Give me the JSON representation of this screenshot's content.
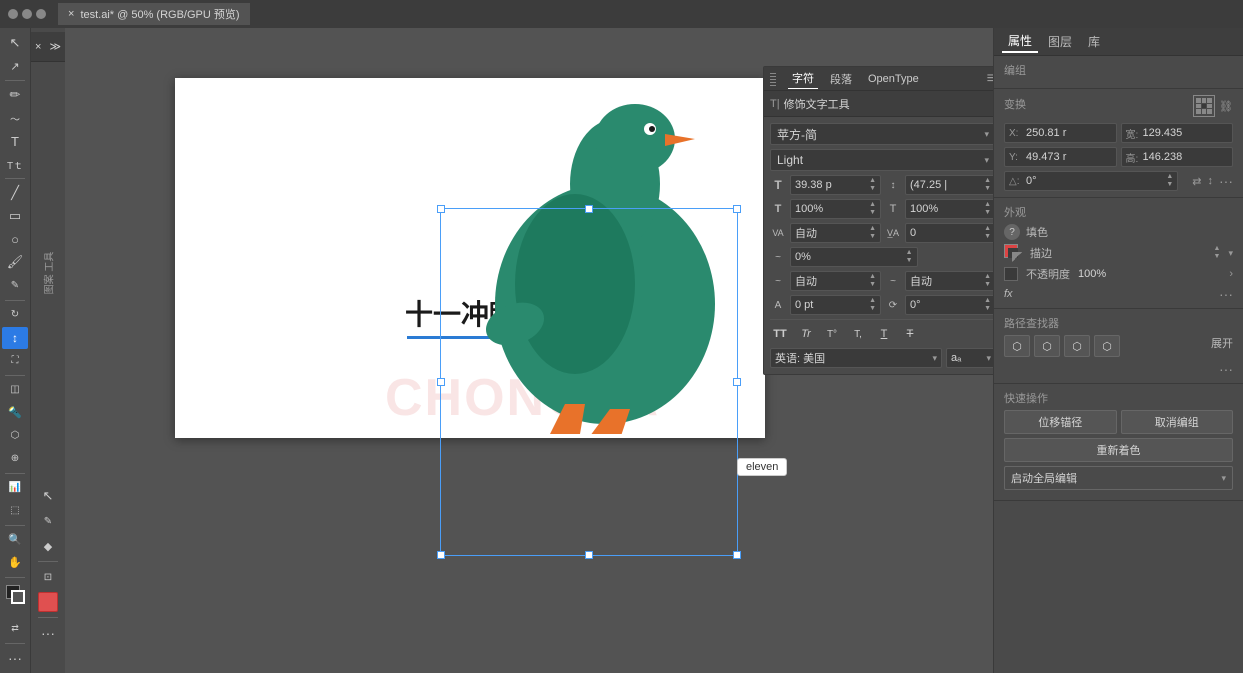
{
  "titlebar": {
    "title": "test.ai* @ 50% (RGB/GPU 预览)",
    "tab_close": "×"
  },
  "toolbar": {
    "tools": [
      "↖",
      "↺",
      "✏",
      "🔍",
      "T",
      "▭",
      "⬟",
      "✂",
      "⬡",
      "✦",
      "⬭",
      "🖊",
      "📐",
      "📏",
      "✒",
      "🎨",
      "🔧",
      "⬡",
      "📊",
      "🔍",
      "⬚",
      "..."
    ]
  },
  "character_panel": {
    "tabs": [
      "字符",
      "段落",
      "OpenType"
    ],
    "active_tab": "字符",
    "modify_tool_label": "修饰文字工具",
    "font_family": "苹方-简",
    "font_style": "Light",
    "size_label": "T",
    "size_value": "39.38 p",
    "leading_label": "↕",
    "leading_value": "(47.25 |",
    "scale_h_label": "T",
    "scale_h_value": "100%",
    "scale_v_label": "T",
    "scale_v_value": "100%",
    "tracking_label": "VA",
    "tracking_value": "自动",
    "kerning_label": "VA",
    "kerning_value": "0",
    "percent_label": "~",
    "percent_value": "0%",
    "auto1_label": "~",
    "auto1_value": "自动",
    "auto2_label": "~",
    "auto2_value": "自动",
    "baseline_label": "A",
    "baseline_value": "0 pt",
    "rotate_label": "⟳",
    "rotate_value": "0°",
    "style_buttons": [
      "TT",
      "Tr",
      "T°",
      "T,",
      "T",
      "T≡"
    ],
    "language": "英语: 美国",
    "aa_value": "aₐ"
  },
  "canvas": {
    "text_main": "十一冲鸭",
    "watermark": "CHONGYA",
    "eleven_tooltip": "eleven"
  },
  "right_panel": {
    "tabs": [
      "属性",
      "图层",
      "库"
    ],
    "active_tab": "属性",
    "section_group": "编组",
    "section_transform": "变换",
    "x_label": "X:",
    "x_value": "250.81 r",
    "width_label": "宽:",
    "width_value": "129.435",
    "y_label": "Y:",
    "y_value": "49.473 r",
    "height_label": "高:",
    "height_value": "146.238",
    "rotation_label": "△:",
    "rotation_value": "0°",
    "section_appearance": "外观",
    "fill_label": "填色",
    "stroke_label": "描边",
    "opacity_label": "不透明度",
    "opacity_value": "100%",
    "fx_label": "fx",
    "section_path": "路径查找器",
    "section_quick": "快速操作",
    "btn_position": "位移锚径",
    "btn_ungroup": "取消编组",
    "btn_recolor": "重新着色",
    "btn_global_edit": "启动全局编辑"
  }
}
